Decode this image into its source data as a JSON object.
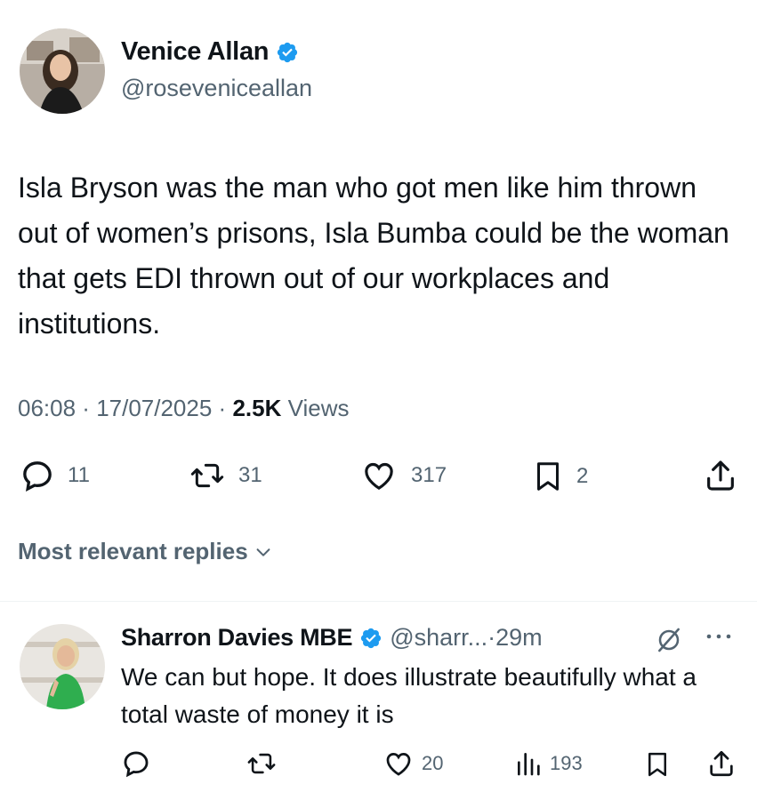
{
  "tweet": {
    "author_name": "Venice Allan",
    "author_handle": "@roseveniceallan",
    "text": "Isla Bryson was the man who got men like him thrown out of women’s prisons, Isla Bumba could be the woman that gets EDI thrown out of our workplaces and institutions.",
    "time": "06:08",
    "date": "17/07/2025",
    "views_count": "2.5K",
    "views_label": "Views",
    "replies": "11",
    "reposts": "31",
    "likes": "317",
    "bookmarks": "2"
  },
  "replies_section": {
    "label": "Most relevant replies"
  },
  "reply": {
    "author_name": "Sharron Davies MBE",
    "author_handle": "@sharr...",
    "age": "29m",
    "text": "We can but hope. It does illustrate beautifully what a total waste of money it is",
    "likes": "20",
    "views": "193"
  },
  "colors": {
    "verified": "#1d9bf0",
    "muted": "#536471",
    "text": "#0f1419"
  },
  "icons": [
    "verified-badge-icon",
    "reply-icon",
    "repost-icon",
    "like-icon",
    "bookmark-icon",
    "share-icon",
    "chevron-down-icon",
    "grok-icon",
    "more-icon",
    "views-icon"
  ]
}
